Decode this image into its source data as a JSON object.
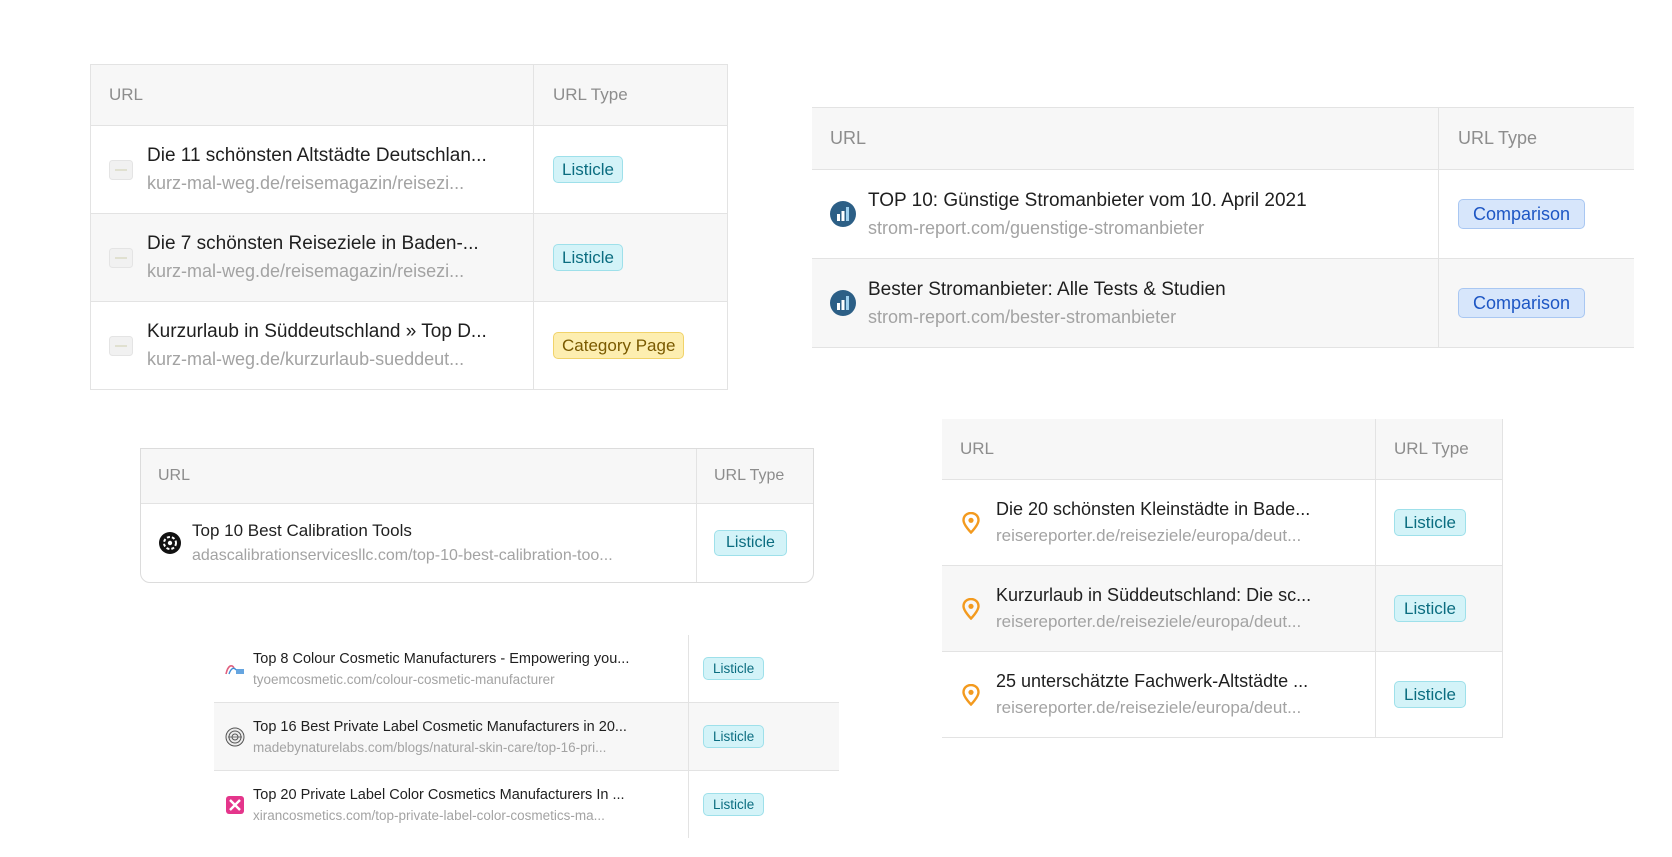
{
  "colors": {
    "listicle_bg": "#d3f3f8",
    "listicle_text": "#0b6d80",
    "category_bg": "#fdeeb0",
    "category_text": "#7a5a00",
    "comparison_bg": "#d7e6fb",
    "comparison_text": "#1d56c4",
    "header_bg": "#f7f7f7",
    "border": "#e3e3e3",
    "muted_text": "#a3a3a3"
  },
  "tables": [
    {
      "headers": {
        "url": "URL",
        "type": "URL Type"
      },
      "rows": [
        {
          "icon": "placeholder-dash-icon",
          "title": "Die 11 schönsten Altstädte Deutschlan...",
          "url": "kurz-mal-weg.de/reisemagazin/reisezi...",
          "type": "Listicle"
        },
        {
          "icon": "placeholder-dash-icon",
          "title": "Die 7 schönsten Reiseziele in Baden-...",
          "url": "kurz-mal-weg.de/reisemagazin/reisezi...",
          "type": "Listicle"
        },
        {
          "icon": "placeholder-dash-icon",
          "title": "Kurzurlaub in Süddeutschland » Top D...",
          "url": "kurz-mal-weg.de/kurzurlaub-sueddeut...",
          "type": "Category Page"
        }
      ]
    },
    {
      "headers": {
        "url": "URL",
        "type": "URL Type"
      },
      "rows": [
        {
          "icon": "bar-chart-icon",
          "title": "TOP 10: Günstige Stromanbieter vom 10. April 2021",
          "url": "strom-report.com/guenstige-stromanbieter",
          "type": "Comparison"
        },
        {
          "icon": "bar-chart-icon",
          "title": "Bester Stromanbieter: Alle Tests & Studien",
          "url": "strom-report.com/bester-stromanbieter",
          "type": "Comparison"
        }
      ]
    },
    {
      "headers": {
        "url": "URL",
        "type": "URL Type"
      },
      "rows": [
        {
          "icon": "gear-logo-icon",
          "title": "Top 10 Best Calibration Tools",
          "url": "adascalibrationservicesllc.com/top-10-best-calibration-too...",
          "type": "Listicle"
        }
      ]
    },
    {
      "headers": {
        "url": "URL",
        "type": "URL Type"
      },
      "rows": [
        {
          "icon": "map-pin-icon",
          "title": "Die 20 schönsten Kleinstädte in Bade...",
          "url": "reisereporter.de/reiseziele/europa/deut...",
          "type": "Listicle"
        },
        {
          "icon": "map-pin-icon",
          "title": "Kurzurlaub in Süddeutschland: Die sc...",
          "url": "reisereporter.de/reiseziele/europa/deut...",
          "type": "Listicle"
        },
        {
          "icon": "map-pin-icon",
          "title": "25 unterschätzte Fachwerk-Altstädte ...",
          "url": "reisereporter.de/reiseziele/europa/deut...",
          "type": "Listicle"
        }
      ]
    },
    {
      "rows": [
        {
          "icon": "tyoem-logo-icon",
          "title": "Top 8 Colour Cosmetic Manufacturers - Empowering you...",
          "url": "tyoemcosmetic.com/colour-cosmetic-manufacturer",
          "type": "Listicle"
        },
        {
          "icon": "fingerprint-logo-icon",
          "title": "Top 16 Best Private Label Cosmetic Manufacturers in 20...",
          "url": "madebynaturelabs.com/blogs/natural-skin-care/top-16-pri...",
          "type": "Listicle"
        },
        {
          "icon": "xiran-logo-icon",
          "title": "Top 20 Private Label Color Cosmetics Manufacturers In ...",
          "url": "xirancosmetics.com/top-private-label-color-cosmetics-ma...",
          "type": "Listicle"
        }
      ]
    }
  ]
}
